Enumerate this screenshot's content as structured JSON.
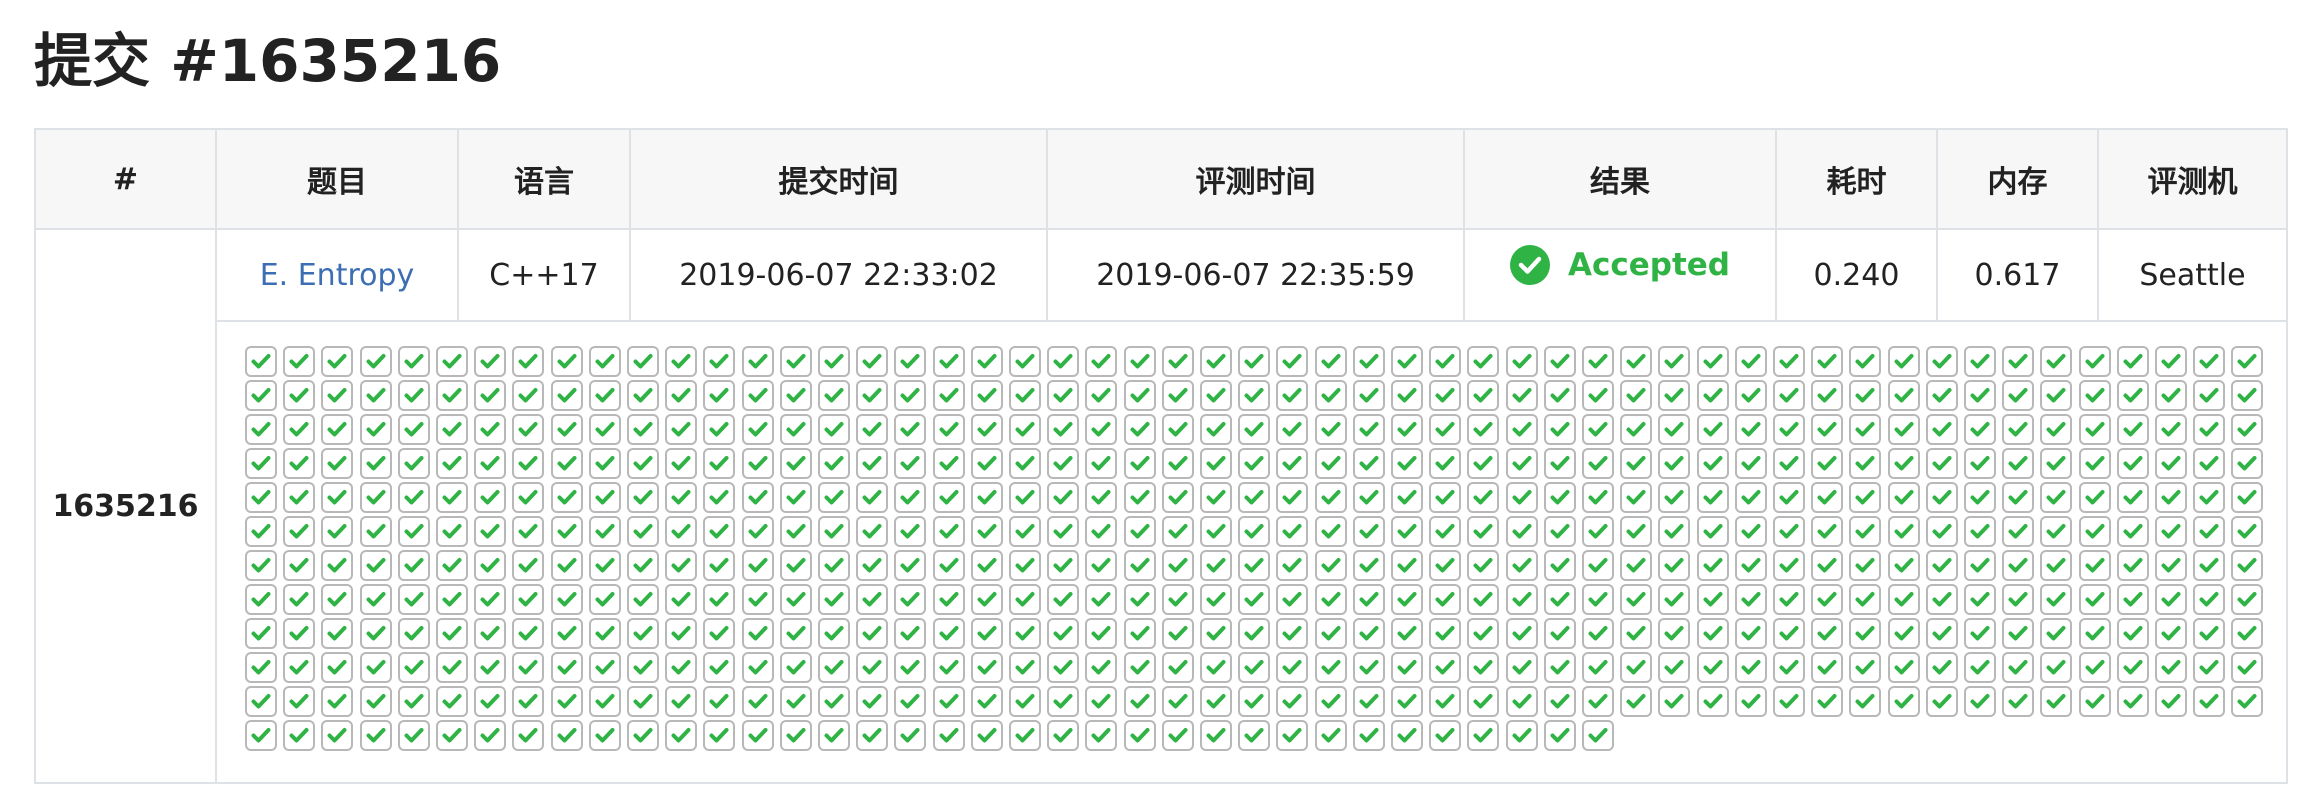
{
  "page": {
    "title": "提交 #1635216"
  },
  "table": {
    "headers": [
      "#",
      "题目",
      "语言",
      "提交时间",
      "评测时间",
      "结果",
      "耗时",
      "内存",
      "评测机"
    ]
  },
  "submission": {
    "id": "1635216",
    "problem": "E. Entropy",
    "language": "C++17",
    "submit_time": "2019-06-07 22:33:02",
    "judge_time": "2019-06-07 22:35:59",
    "result": "Accepted",
    "time": "0.240",
    "memory": "0.617",
    "judger": "Seattle"
  },
  "test_cases": {
    "status": "accepted",
    "count": 619,
    "per_row": 53,
    "icon": "check-icon"
  },
  "colors": {
    "accepted": "#2fb344",
    "link": "#3c6eb4",
    "border": "#dee2e6",
    "header_bg": "#f7f7f8"
  }
}
